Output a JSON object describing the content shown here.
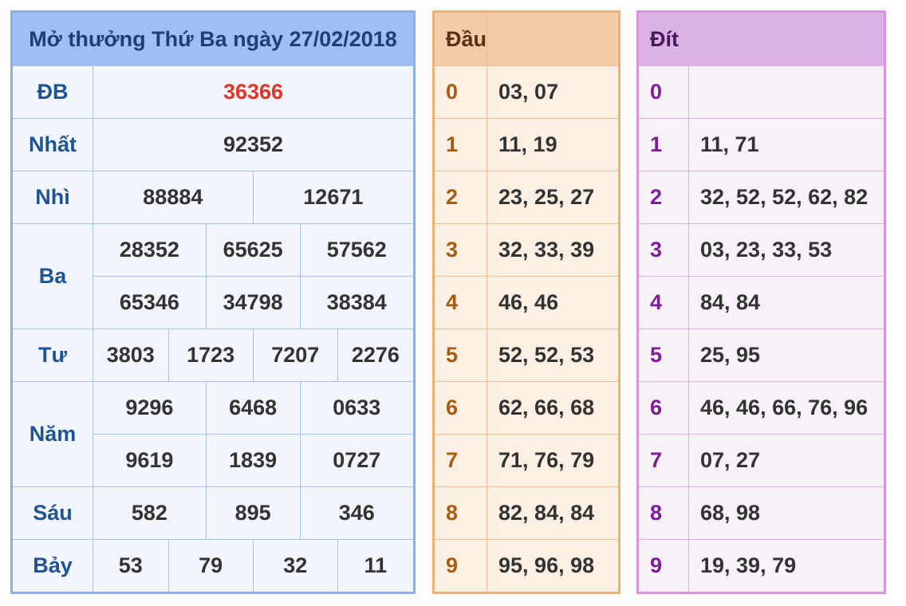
{
  "results": {
    "title": "Mở thưởng Thứ Ba ngày 27/02/2018",
    "prizes": [
      {
        "label": "ĐB",
        "numbers": [
          "36366"
        ]
      },
      {
        "label": "Nhất",
        "numbers": [
          "92352"
        ]
      },
      {
        "label": "Nhì",
        "numbers": [
          "88884",
          "12671"
        ]
      },
      {
        "label": "Ba",
        "numbers": [
          "28352",
          "65625",
          "57562",
          "65346",
          "34798",
          "38384"
        ]
      },
      {
        "label": "Tư",
        "numbers": [
          "3803",
          "1723",
          "7207",
          "2276"
        ]
      },
      {
        "label": "Năm",
        "numbers": [
          "9296",
          "6468",
          "0633",
          "9619",
          "1839",
          "0727"
        ]
      },
      {
        "label": "Sáu",
        "numbers": [
          "582",
          "895",
          "346"
        ]
      },
      {
        "label": "Bảy",
        "numbers": [
          "53",
          "79",
          "32",
          "11"
        ]
      }
    ]
  },
  "dau": {
    "header": "Đầu",
    "rows": [
      {
        "digit": "0",
        "values": "03, 07"
      },
      {
        "digit": "1",
        "values": "11, 19"
      },
      {
        "digit": "2",
        "values": "23, 25, 27"
      },
      {
        "digit": "3",
        "values": "32, 33, 39"
      },
      {
        "digit": "4",
        "values": "46, 46"
      },
      {
        "digit": "5",
        "values": "52, 52, 53"
      },
      {
        "digit": "6",
        "values": "62, 66, 68"
      },
      {
        "digit": "7",
        "values": "71, 76, 79"
      },
      {
        "digit": "8",
        "values": "82, 84, 84"
      },
      {
        "digit": "9",
        "values": "95, 96, 98"
      }
    ]
  },
  "dit": {
    "header": "Đít",
    "rows": [
      {
        "digit": "0",
        "values": ""
      },
      {
        "digit": "1",
        "values": "11, 71"
      },
      {
        "digit": "2",
        "values": "32, 52, 52, 62, 82"
      },
      {
        "digit": "3",
        "values": "03, 23, 33, 53"
      },
      {
        "digit": "4",
        "values": "84, 84"
      },
      {
        "digit": "5",
        "values": "25, 95"
      },
      {
        "digit": "6",
        "values": "46, 46, 66, 76, 96"
      },
      {
        "digit": "7",
        "values": "07, 27"
      },
      {
        "digit": "8",
        "values": "68, 98"
      },
      {
        "digit": "9",
        "values": "19, 39, 79"
      }
    ]
  },
  "colors": {
    "special_prize": "#e0352b",
    "results_header": "#9ebff2",
    "dau_header": "#f2cba8",
    "dit_header": "#dbb2e5"
  }
}
